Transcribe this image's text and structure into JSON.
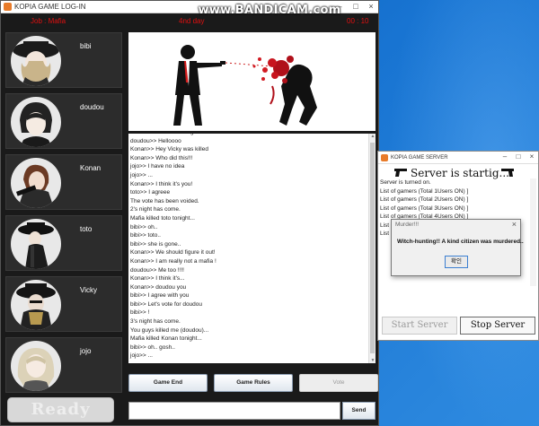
{
  "watermark": "www.BANDICAM.com",
  "game_window": {
    "title": "KOPIA GAME LOG-IN",
    "job": "Job : Mafia",
    "day": "4nd day",
    "timer": "00 : 10",
    "players": [
      {
        "name": "bibi"
      },
      {
        "name": "doudou"
      },
      {
        "name": "Konan"
      },
      {
        "name": "toto"
      },
      {
        "name": "Vicky"
      },
      {
        "name": "jojo"
      }
    ],
    "ready_label": "Ready",
    "chat_lines": [
      "doudou>> Goodmorning",
      "doudou>> Helloooo",
      "Konan>> Hey Vicky was killed",
      "Konan>> Who did this!!!",
      "jojo>> I have no idea",
      "jojo>> ...",
      "Konan>> I think it's you!",
      "toto>> I agreee",
      "The vote has been voided.",
      "2's night has come.",
      "Mafia killed toto tonight...",
      " bibi>> oh..",
      " bibi>> toto..",
      " bibi>> she is gone..",
      "Konan>> We should figure it out!",
      "Konan>> I am really not a mafia !",
      "doudou>> Me too !!!!",
      "Konan>> I think it's...",
      "Konan>> doudou you",
      " bibi>> I agree with you",
      " bibi>> Let's vote for doudou",
      " bibi>> !",
      "3's night has come.",
      "You guys killed me (doudou)...",
      "Mafia killed Konan tonight...",
      " bibi>> oh.. gosh..",
      "jojo>> ..."
    ],
    "buttons": {
      "game_end": "Game End",
      "game_rules": "Game Rules",
      "vote": "Vote",
      "send": "Send"
    },
    "message_input": ""
  },
  "server_window": {
    "title": "KOPIA GAME SERVER",
    "banner": "Server is startig...",
    "log_lines": [
      "Server is turned on.",
      "List of gamers (Total 1Users ON) ]",
      "List of gamers (Total 2Users ON) ]",
      "List of gamers (Total 3Users ON) ]",
      "List of gamers (Total 4Users ON) ]",
      "List of gamers (Total 5Users ON) ]",
      "List of gamers (Total 6Users ON) ]"
    ],
    "start_label": "Start Server",
    "stop_label": "Stop Server"
  },
  "dialog": {
    "title": "Murder!!!",
    "message": "Witch-hunting!! A kind citizen was murdered..",
    "ok_label": "확인"
  },
  "colors": {
    "hud_red": "#e01010",
    "game_bg": "#1a1a1a",
    "desktop_blue": "#1874d2"
  }
}
